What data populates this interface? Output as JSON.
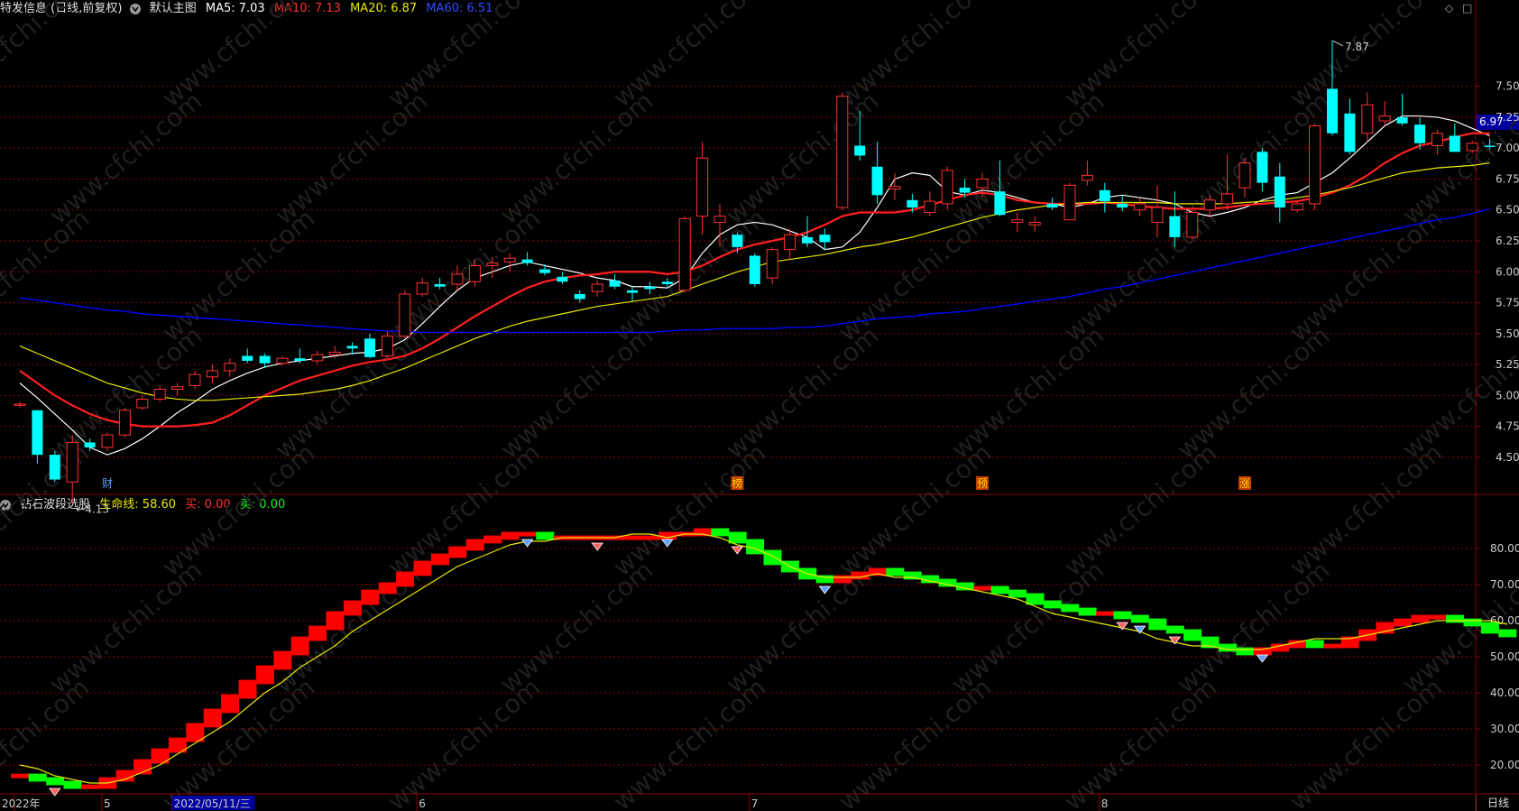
{
  "main_panel": {
    "title": "特发信息 (日线,前复权)",
    "indicator_name": "默认主图",
    "ma5_label": "MA5: 7.03",
    "ma10_label": "MA10: 7.13",
    "ma20_label": "MA20: 6.87",
    "ma60_label": "MA60: 6.51",
    "current_price": "6.97",
    "high_annotation": "7.87",
    "low_annotation": "4.13",
    "markers": [
      "财",
      "榜",
      "预",
      "涨"
    ]
  },
  "sub_panel": {
    "indicator_name": "钻石波段选股",
    "life_line_label": "生命线: 58.60",
    "buy_label": "买: 0.00",
    "sell_label": "卖: 0.00"
  },
  "date_axis": [
    "2022年",
    "5",
    "2022/05/11/三",
    "6",
    "7",
    "8"
  ],
  "period_button": "日线",
  "colors": {
    "up": "#ff3232",
    "down": "#00ffff",
    "ma5": "#ffffff",
    "ma10": "#ff2020",
    "ma20": "#e8e800",
    "ma60": "#0000ff",
    "band_up": "#ff0000",
    "band_down": "#00ff00",
    "grid": "#8b0000",
    "watermark": "#1f1f1f"
  },
  "chart_data": [
    {
      "type": "candlestick",
      "title": "特发信息 (日线,前复权)",
      "ylim": [
        4.2,
        7.95
      ],
      "yticks": [
        "7.50",
        "7.25",
        "7.00",
        "6.75",
        "6.50",
        "6.25",
        "6.00",
        "5.75",
        "5.50",
        "5.25",
        "5.00",
        "4.75",
        "4.50"
      ],
      "candles": [
        [
          4.92,
          4.95,
          4.9,
          4.93
        ],
        [
          4.88,
          4.88,
          4.45,
          4.52
        ],
        [
          4.52,
          4.55,
          4.3,
          4.32
        ],
        [
          4.3,
          4.68,
          4.13,
          4.62
        ],
        [
          4.62,
          4.65,
          4.55,
          4.58
        ],
        [
          4.58,
          4.7,
          4.55,
          4.68
        ],
        [
          4.68,
          4.9,
          4.66,
          4.88
        ],
        [
          4.9,
          5.0,
          4.88,
          4.97
        ],
        [
          4.97,
          5.08,
          4.95,
          5.05
        ],
        [
          5.05,
          5.1,
          5.0,
          5.07
        ],
        [
          5.08,
          5.2,
          5.05,
          5.17
        ],
        [
          5.15,
          5.25,
          5.1,
          5.2
        ],
        [
          5.2,
          5.3,
          5.15,
          5.26
        ],
        [
          5.32,
          5.38,
          5.26,
          5.28
        ],
        [
          5.32,
          5.34,
          5.22,
          5.26
        ],
        [
          5.26,
          5.32,
          5.24,
          5.3
        ],
        [
          5.3,
          5.38,
          5.26,
          5.28
        ],
        [
          5.28,
          5.36,
          5.25,
          5.33
        ],
        [
          5.33,
          5.4,
          5.3,
          5.35
        ],
        [
          5.4,
          5.43,
          5.33,
          5.38
        ],
        [
          5.46,
          5.5,
          5.3,
          5.31
        ],
        [
          5.32,
          5.52,
          5.3,
          5.48
        ],
        [
          5.48,
          5.85,
          5.46,
          5.82
        ],
        [
          5.82,
          5.95,
          5.8,
          5.91
        ],
        [
          5.9,
          5.95,
          5.86,
          5.88
        ],
        [
          5.9,
          6.05,
          5.85,
          5.98
        ],
        [
          5.92,
          6.1,
          5.88,
          6.05
        ],
        [
          6.05,
          6.12,
          5.95,
          6.07
        ],
        [
          6.08,
          6.15,
          6.0,
          6.11
        ],
        [
          6.1,
          6.16,
          6.05,
          6.07
        ],
        [
          6.02,
          6.06,
          5.97,
          5.99
        ],
        [
          5.96,
          6.0,
          5.9,
          5.92
        ],
        [
          5.82,
          5.85,
          5.75,
          5.78
        ],
        [
          5.84,
          5.93,
          5.8,
          5.9
        ],
        [
          5.93,
          5.98,
          5.86,
          5.88
        ],
        [
          5.85,
          5.88,
          5.76,
          5.83
        ],
        [
          5.88,
          5.92,
          5.82,
          5.86
        ],
        [
          5.92,
          5.95,
          5.88,
          5.9
        ],
        [
          5.85,
          6.45,
          5.83,
          6.43
        ],
        [
          6.45,
          7.05,
          6.3,
          6.92
        ],
        [
          6.4,
          6.55,
          6.2,
          6.45
        ],
        [
          6.3,
          6.32,
          6.15,
          6.2
        ],
        [
          6.13,
          6.15,
          5.88,
          5.9
        ],
        [
          5.95,
          6.2,
          5.9,
          6.18
        ],
        [
          6.18,
          6.35,
          6.1,
          6.3
        ],
        [
          6.28,
          6.45,
          6.2,
          6.23
        ],
        [
          6.3,
          6.35,
          6.18,
          6.24
        ],
        [
          6.52,
          7.45,
          6.5,
          7.42
        ],
        [
          7.02,
          7.3,
          6.9,
          6.94
        ],
        [
          6.85,
          7.05,
          6.55,
          6.62
        ],
        [
          6.67,
          6.8,
          6.58,
          6.69
        ],
        [
          6.58,
          6.63,
          6.48,
          6.52
        ],
        [
          6.48,
          6.65,
          6.45,
          6.57
        ],
        [
          6.55,
          6.85,
          6.5,
          6.82
        ],
        [
          6.68,
          6.75,
          6.6,
          6.64
        ],
        [
          6.68,
          6.8,
          6.6,
          6.75
        ],
        [
          6.65,
          6.9,
          6.45,
          6.46
        ],
        [
          6.4,
          6.48,
          6.32,
          6.42
        ],
        [
          6.38,
          6.45,
          6.32,
          6.4
        ],
        [
          6.55,
          6.6,
          6.5,
          6.52
        ],
        [
          6.42,
          6.72,
          6.42,
          6.7
        ],
        [
          6.74,
          6.9,
          6.7,
          6.78
        ],
        [
          6.66,
          6.72,
          6.48,
          6.57
        ],
        [
          6.55,
          6.62,
          6.49,
          6.52
        ],
        [
          6.5,
          6.6,
          6.45,
          6.55
        ],
        [
          6.4,
          6.7,
          6.28,
          6.52
        ],
        [
          6.45,
          6.65,
          6.2,
          6.28
        ],
        [
          6.28,
          6.5,
          6.26,
          6.48
        ],
        [
          6.5,
          6.62,
          6.44,
          6.58
        ],
        [
          6.55,
          6.95,
          6.5,
          6.63
        ],
        [
          6.68,
          6.92,
          6.6,
          6.88
        ],
        [
          6.97,
          7.0,
          6.65,
          6.72
        ],
        [
          6.77,
          6.88,
          6.4,
          6.52
        ],
        [
          6.5,
          6.58,
          6.48,
          6.55
        ],
        [
          6.55,
          7.2,
          6.5,
          7.18
        ],
        [
          7.48,
          7.87,
          7.1,
          7.12
        ],
        [
          7.28,
          7.4,
          6.95,
          6.97
        ],
        [
          7.12,
          7.45,
          7.05,
          7.35
        ],
        [
          7.22,
          7.38,
          7.18,
          7.26
        ],
        [
          7.25,
          7.44,
          7.18,
          7.2
        ],
        [
          7.19,
          7.25,
          6.99,
          7.04
        ],
        [
          7.02,
          7.15,
          6.95,
          7.12
        ],
        [
          7.1,
          7.2,
          7.0,
          6.97
        ],
        [
          6.98,
          7.06,
          6.96,
          7.04
        ],
        [
          7.02,
          7.08,
          6.99,
          7.01
        ]
      ],
      "ma_series": [
        {
          "name": "MA5",
          "values": [
            5.1,
            4.98,
            4.85,
            4.72,
            4.58,
            4.52,
            4.57,
            4.65,
            4.75,
            4.86,
            4.95,
            5.05,
            5.12,
            5.18,
            5.23,
            5.26,
            5.28,
            5.3,
            5.32,
            5.34,
            5.35,
            5.38,
            5.45,
            5.58,
            5.72,
            5.85,
            5.95,
            6.0,
            6.05,
            6.08,
            6.05,
            6.02,
            5.99,
            5.95,
            5.93,
            5.88,
            5.88,
            5.87,
            5.95,
            6.15,
            6.3,
            6.38,
            6.4,
            6.38,
            6.33,
            6.28,
            6.18,
            6.2,
            6.32,
            6.52,
            6.75,
            6.8,
            6.78,
            6.65,
            6.62,
            6.66,
            6.64,
            6.6,
            6.56,
            6.55,
            6.52,
            6.55,
            6.6,
            6.62,
            6.6,
            6.58,
            6.55,
            6.48,
            6.45,
            6.48,
            6.52,
            6.58,
            6.62,
            6.64,
            6.72,
            6.8,
            6.92,
            7.05,
            7.18,
            7.26,
            7.26,
            7.25,
            7.22,
            7.16,
            7.1
          ]
        },
        {
          "name": "MA10",
          "values": [
            5.2,
            5.1,
            5.0,
            4.92,
            4.85,
            4.8,
            4.77,
            4.75,
            4.75,
            4.75,
            4.76,
            4.78,
            4.84,
            4.92,
            5.0,
            5.06,
            5.12,
            5.16,
            5.2,
            5.24,
            5.27,
            5.29,
            5.32,
            5.38,
            5.46,
            5.55,
            5.64,
            5.72,
            5.8,
            5.87,
            5.92,
            5.95,
            5.97,
            5.98,
            6.0,
            6.0,
            6.0,
            5.98,
            6.0,
            6.05,
            6.12,
            6.18,
            6.22,
            6.25,
            6.28,
            6.32,
            6.38,
            6.45,
            6.48,
            6.48,
            6.48,
            6.5,
            6.54,
            6.58,
            6.62,
            6.64,
            6.62,
            6.58,
            6.56,
            6.55,
            6.55,
            6.55,
            6.56,
            6.55,
            6.53,
            6.52,
            6.51,
            6.51,
            6.51,
            6.52,
            6.54,
            6.55,
            6.56,
            6.57,
            6.6,
            6.64,
            6.7,
            6.78,
            6.88,
            6.96,
            7.02,
            7.05,
            7.09,
            7.12,
            7.12
          ]
        },
        {
          "name": "MA20",
          "values": [
            5.4,
            5.34,
            5.28,
            5.22,
            5.16,
            5.1,
            5.06,
            5.02,
            4.99,
            4.97,
            4.96,
            4.96,
            4.97,
            4.98,
            4.99,
            5.0,
            5.01,
            5.03,
            5.05,
            5.08,
            5.12,
            5.17,
            5.22,
            5.28,
            5.34,
            5.4,
            5.46,
            5.51,
            5.56,
            5.6,
            5.63,
            5.66,
            5.69,
            5.72,
            5.74,
            5.76,
            5.78,
            5.8,
            5.85,
            5.9,
            5.95,
            6.0,
            6.04,
            6.08,
            6.1,
            6.12,
            6.14,
            6.17,
            6.2,
            6.22,
            6.25,
            6.28,
            6.32,
            6.36,
            6.4,
            6.44,
            6.47,
            6.5,
            6.52,
            6.54,
            6.55,
            6.56,
            6.56,
            6.56,
            6.56,
            6.56,
            6.55,
            6.55,
            6.55,
            6.55,
            6.56,
            6.57,
            6.58,
            6.6,
            6.62,
            6.65,
            6.68,
            6.72,
            6.76,
            6.8,
            6.82,
            6.84,
            6.85,
            6.86,
            6.88
          ]
        },
        {
          "name": "MA60",
          "values": [
            5.79,
            5.77,
            5.75,
            5.73,
            5.71,
            5.69,
            5.68,
            5.66,
            5.65,
            5.64,
            5.63,
            5.62,
            5.61,
            5.6,
            5.59,
            5.58,
            5.57,
            5.56,
            5.55,
            5.54,
            5.53,
            5.52,
            5.52,
            5.51,
            5.51,
            5.51,
            5.51,
            5.51,
            5.51,
            5.51,
            5.51,
            5.51,
            5.51,
            5.51,
            5.51,
            5.51,
            5.51,
            5.52,
            5.53,
            5.53,
            5.54,
            5.54,
            5.54,
            5.54,
            5.55,
            5.55,
            5.56,
            5.58,
            5.6,
            5.62,
            5.63,
            5.64,
            5.66,
            5.67,
            5.68,
            5.7,
            5.72,
            5.74,
            5.76,
            5.78,
            5.8,
            5.83,
            5.86,
            5.88,
            5.91,
            5.94,
            5.97,
            6.0,
            6.03,
            6.06,
            6.09,
            6.12,
            6.15,
            6.18,
            6.21,
            6.24,
            6.27,
            6.3,
            6.33,
            6.36,
            6.39,
            6.42,
            6.44,
            6.47,
            6.51
          ]
        }
      ]
    },
    {
      "type": "step-band",
      "title": "钻石波段选股",
      "ylim": [
        12,
        87
      ],
      "yticks": [
        "80.00",
        "70.00",
        "60.00",
        "50.00",
        "40.00",
        "30.00",
        "20.00"
      ],
      "band": [
        17,
        16,
        15,
        14,
        14,
        16,
        18,
        21,
        24,
        27,
        31,
        35,
        39,
        43,
        47,
        51,
        55,
        58,
        62,
        65,
        68,
        70,
        73,
        76,
        78,
        80,
        82,
        83,
        84,
        84,
        83,
        83,
        83,
        83,
        83,
        83,
        83,
        84,
        84,
        85,
        84,
        82,
        79,
        76,
        74,
        72,
        71,
        72,
        73,
        74,
        73,
        72,
        71,
        70,
        69,
        69,
        68,
        67,
        65,
        64,
        63,
        62,
        62,
        61,
        60,
        58,
        57,
        55,
        53,
        52,
        51,
        52,
        53,
        54,
        53,
        53,
        55,
        57,
        59,
        60,
        61,
        61,
        60,
        59,
        57,
        56
      ],
      "life_line": [
        20,
        19,
        17,
        16,
        15,
        15,
        16,
        18,
        20,
        23,
        26,
        29,
        32,
        36,
        40,
        43,
        47,
        50,
        53,
        57,
        60,
        63,
        66,
        69,
        72,
        75,
        77,
        79,
        81,
        82,
        82,
        83,
        83,
        83,
        83,
        84,
        84,
        83,
        84,
        84,
        83,
        81,
        80,
        78,
        75,
        73,
        72,
        72,
        72,
        73,
        72,
        72,
        71,
        70,
        69,
        68,
        67,
        66,
        64,
        62,
        61,
        60,
        59,
        58,
        57,
        55,
        54,
        53,
        53,
        52,
        52,
        52,
        53,
        54,
        55,
        55,
        55,
        56,
        57,
        58,
        59,
        60,
        60,
        60,
        60,
        59
      ]
    }
  ]
}
